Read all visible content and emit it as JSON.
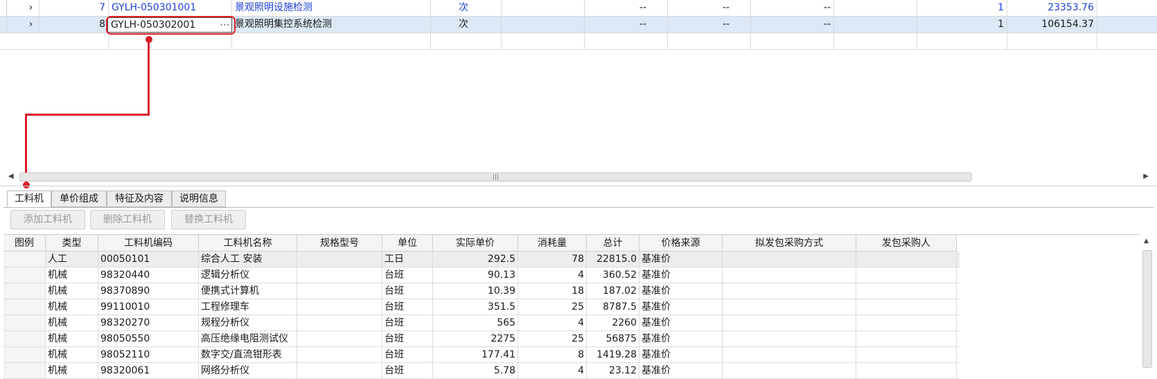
{
  "top_rows": [
    {
      "no": "7",
      "code": "GYLH-050301001",
      "name": "景观照明设施检测",
      "unit": "次",
      "c1": "--",
      "c2": "--",
      "c3": "--",
      "qty": "1",
      "price": "23353.76"
    },
    {
      "no": "8",
      "code": "GYLH-050302001",
      "name": "景观照明集控系统检测",
      "unit": "次",
      "c1": "--",
      "c2": "--",
      "c3": "--",
      "qty": "1",
      "price": "106154.37"
    }
  ],
  "editor_dots": "···",
  "tabs": [
    "工料机",
    "单价组成",
    "特征及内容",
    "说明信息"
  ],
  "toolbar": {
    "add": "添加工料机",
    "delete": "删除工料机",
    "replace": "替换工料机"
  },
  "columns": [
    "图例",
    "类型",
    "工料机编码",
    "工料机名称",
    "规格型号",
    "单位",
    "实际单价",
    "消耗量",
    "总计",
    "价格来源",
    "拟发包采购方式",
    "发包采购人"
  ],
  "rows": [
    {
      "type": "人工",
      "code": "00050101",
      "name": "综合人工 安装",
      "unit": "工日",
      "price": "292.5",
      "qty": "78",
      "total": "22815.0",
      "source": "基准价"
    },
    {
      "type": "机械",
      "code": "98320440",
      "name": "逻辑分析仪",
      "unit": "台班",
      "price": "90.13",
      "qty": "4",
      "total": "360.52",
      "source": "基准价"
    },
    {
      "type": "机械",
      "code": "98370890",
      "name": "便携式计算机",
      "unit": "台班",
      "price": "10.39",
      "qty": "18",
      "total": "187.02",
      "source": "基准价"
    },
    {
      "type": "机械",
      "code": "99110010",
      "name": "工程修理车",
      "unit": "台班",
      "price": "351.5",
      "qty": "25",
      "total": "8787.5",
      "source": "基准价"
    },
    {
      "type": "机械",
      "code": "98320270",
      "name": "规程分析仪",
      "unit": "台班",
      "price": "565",
      "qty": "4",
      "total": "2260",
      "source": "基准价"
    },
    {
      "type": "机械",
      "code": "98050550",
      "name": "高压绝缘电阻测试仪",
      "unit": "台班",
      "price": "2275",
      "qty": "25",
      "total": "56875",
      "source": "基准价"
    },
    {
      "type": "机械",
      "code": "98052110",
      "name": "数字交/直流钳形表",
      "unit": "台班",
      "price": "177.41",
      "qty": "8",
      "total": "1419.28",
      "source": "基准价"
    },
    {
      "type": "机械",
      "code": "98320061",
      "name": "网络分析仪",
      "unit": "台班",
      "price": "5.78",
      "qty": "4",
      "total": "23.12",
      "source": "基准价"
    }
  ]
}
